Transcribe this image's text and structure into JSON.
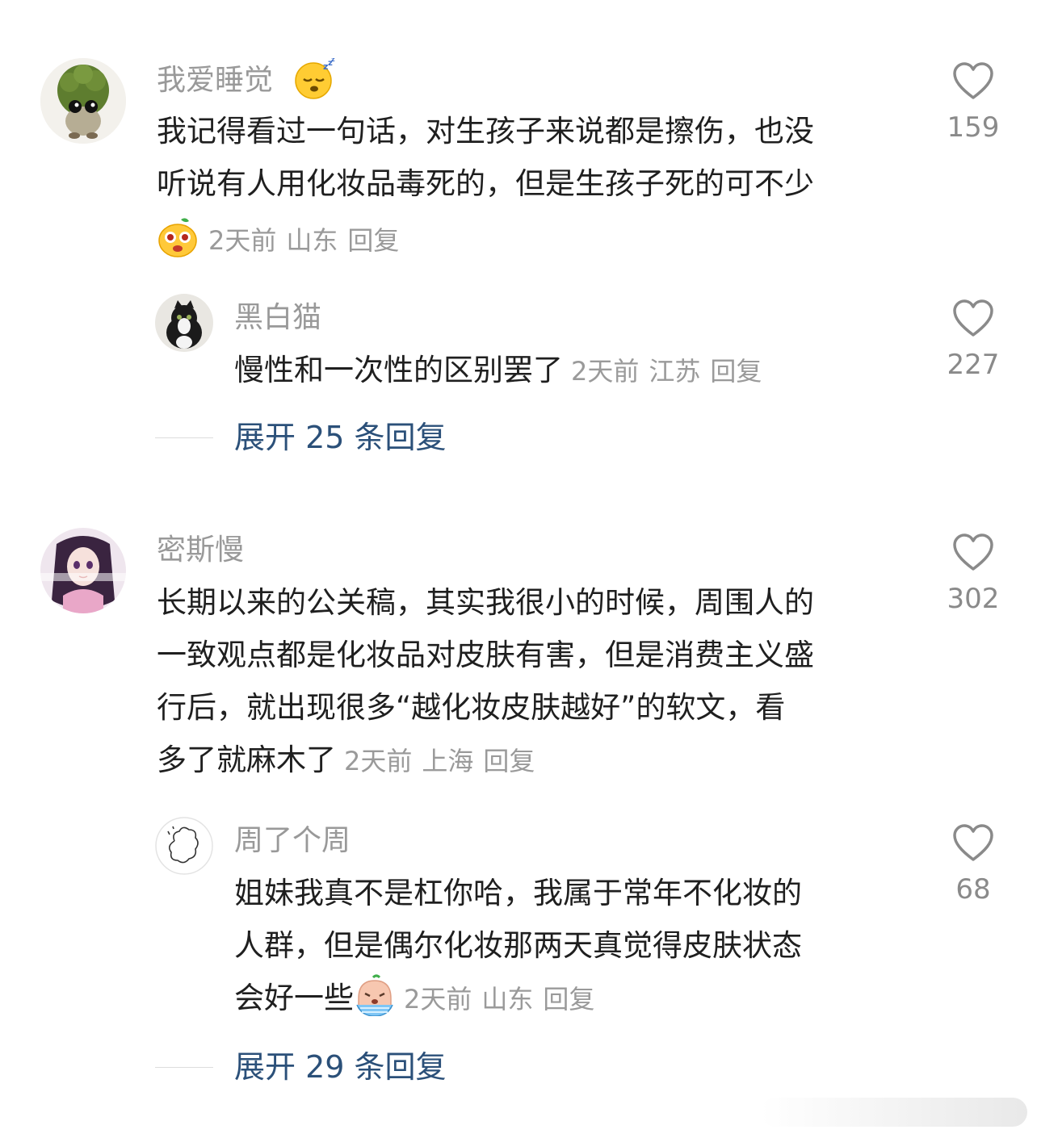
{
  "comments": [
    {
      "username": "我爱睡觉",
      "name_emoji": "sleeping-face-emoji",
      "text_lines": [
        "我记得看过一句话，对生孩子来说都是擦伤，也没",
        "听说有人用化妆品毒死的，但是生孩子死的可不少"
      ],
      "time": "2天前",
      "location": "山东",
      "reply_label": "回复",
      "likes": "159",
      "replies": [
        {
          "username": "黑白猫",
          "text": "慢性和一次性的区别罢了",
          "time": "2天前",
          "location": "江苏",
          "reply_label": "回复",
          "likes": "227"
        }
      ],
      "expand_label": "展开 25 条回复"
    },
    {
      "username": "密斯慢",
      "text_lines": [
        "长期以来的公关稿，其实我很小的时候，周围人的",
        "一致观点都是化妆品对皮肤有害，但是消费主义盛",
        "行后，就出现很多“越化妆皮肤越好”的软文，看",
        "多了就麻木了"
      ],
      "time": "2天前",
      "location": "上海",
      "reply_label": "回复",
      "likes": "302",
      "replies": [
        {
          "username": "周了个周",
          "text_lines": [
            "姐妹我真不是杠你哈，我属于常年不化妆的",
            "人群，但是偶尔化妆那两天真觉得皮肤状态",
            "会好一些"
          ],
          "text_emoji": "crying-emoji",
          "time": "2天前",
          "location": "山东",
          "reply_label": "回复",
          "likes": "68"
        }
      ],
      "expand_label": "展开 29 条回复"
    }
  ],
  "colors": {
    "username": "#999999",
    "meta": "#9a9a9a",
    "link": "#2b5079",
    "body_text": "#1f1f1f"
  }
}
